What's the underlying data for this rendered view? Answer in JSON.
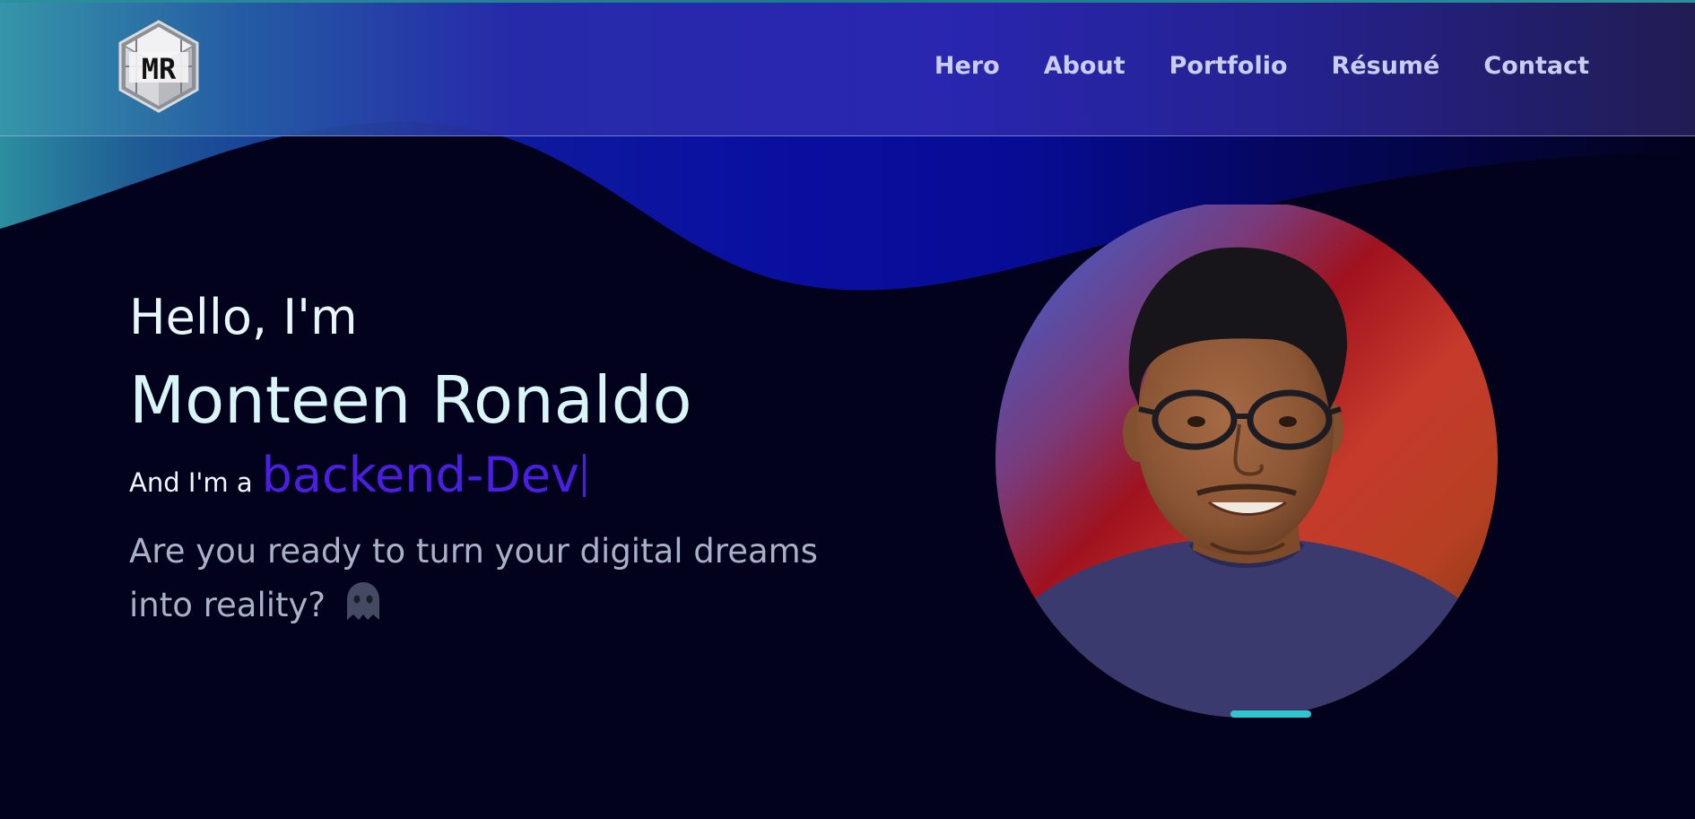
{
  "colors": {
    "background": "#03021c",
    "header_start": "#3796aa",
    "header_mid": "#2c28b2",
    "header_end": "#231e55",
    "wave": "#0a0fa0",
    "accent_typed": "#4a1fe0",
    "name_text": "#d9f5f8",
    "muted_text": "#a8b1c8",
    "nav_text": "#c9cdf0",
    "portrait_teal_base": "#2fc6cf"
  },
  "header": {
    "logo_text": "MR",
    "logo_icon": "cube-logo-icon",
    "nav": [
      {
        "label": "Hero"
      },
      {
        "label": "About"
      },
      {
        "label": "Portfolio"
      },
      {
        "label": "Résumé"
      },
      {
        "label": "Contact"
      }
    ]
  },
  "hero": {
    "greeting": "Hello, I'm",
    "name": "Monteen Ronaldo",
    "role_prefix": "And I'm a",
    "role_typed": "backend-Dev",
    "tagline": "Are you ready to turn your digital dreams into reality?",
    "tagline_icon": "ghost-icon"
  },
  "portrait": {
    "icon": "profile-photo"
  }
}
